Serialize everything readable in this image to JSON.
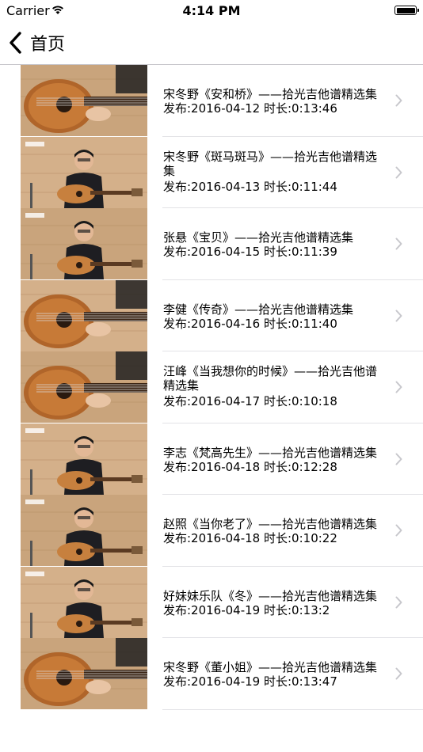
{
  "status_bar": {
    "carrier": "Carrier",
    "time": "4:14 PM"
  },
  "nav": {
    "back_label": "首页"
  },
  "videos": [
    {
      "title": "宋冬野《安和桥》——拾光吉他谱精选集",
      "meta": "发布:2016-04-12 时长:0:13:46",
      "thumb": "closeup"
    },
    {
      "title": "宋冬野《斑马斑马》——拾光吉他谱精选集",
      "meta": "发布:2016-04-13 时长:0:11:44",
      "thumb": "player"
    },
    {
      "title": "张悬《宝贝》——拾光吉他谱精选集",
      "meta": "发布:2016-04-15 时长:0:11:39",
      "thumb": "player"
    },
    {
      "title": "李健《传奇》——拾光吉他谱精选集",
      "meta": "发布:2016-04-16 时长:0:11:40",
      "thumb": "closeup"
    },
    {
      "title": "汪峰《当我想你的时候》——拾光吉他谱精选集",
      "meta": "发布:2016-04-17 时长:0:10:18",
      "thumb": "closeup"
    },
    {
      "title": "李志《梵高先生》——拾光吉他谱精选集",
      "meta": "发布:2016-04-18 时长:0:12:28",
      "thumb": "player"
    },
    {
      "title": "赵照《当你老了》——拾光吉他谱精选集",
      "meta": "发布:2016-04-18 时长:0:10:22",
      "thumb": "player"
    },
    {
      "title": "好妹妹乐队《冬》——拾光吉他谱精选集",
      "meta": "发布:2016-04-19 时长:0:13:2",
      "thumb": "player"
    },
    {
      "title": "宋冬野《董小姐》——拾光吉他谱精选集",
      "meta": "发布:2016-04-19 时长:0:13:47",
      "thumb": "closeup"
    }
  ],
  "icons": {
    "back": "chevron-left-icon",
    "disclosure": "chevron-right-icon",
    "wifi": "wifi-icon",
    "battery": "battery-icon"
  },
  "colors": {
    "separator": "#e2e2e6",
    "chevron": "#c7c7cc",
    "wood": "#c9a47c"
  }
}
